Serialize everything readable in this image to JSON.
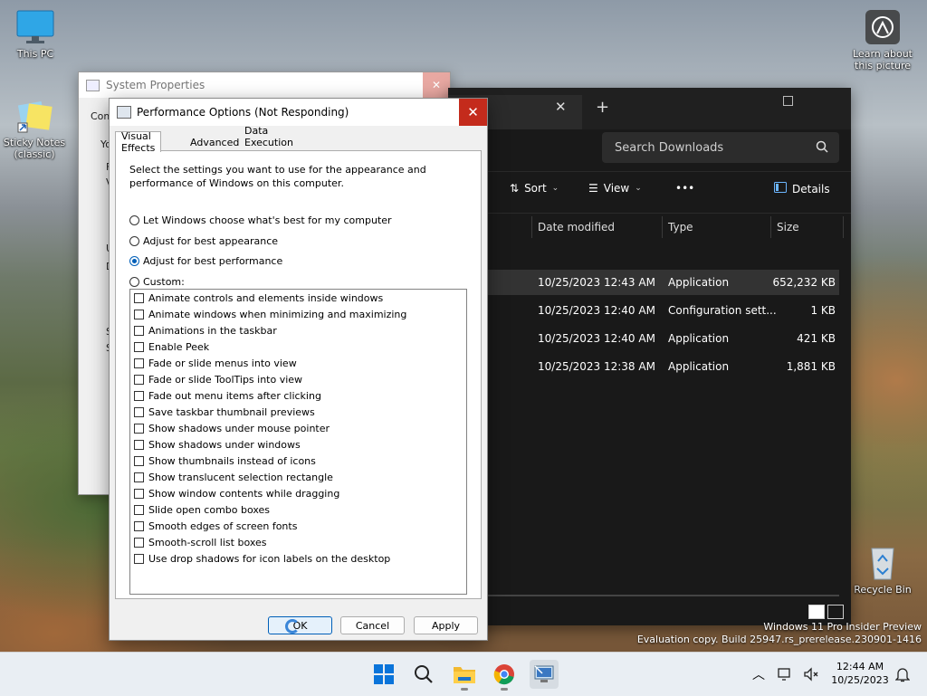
{
  "desktop": {
    "icons": [
      {
        "label": "This PC"
      },
      {
        "label": "Sticky Notes (classic)"
      },
      {
        "label": "Learn about this picture"
      },
      {
        "label": "Recycle Bin"
      }
    ]
  },
  "system_properties": {
    "title": "System Properties",
    "fragments": [
      "Com",
      "Yo",
      "F",
      "V",
      "U",
      "D",
      "S",
      "S"
    ]
  },
  "explorer": {
    "search_placeholder": "Search Downloads",
    "toolbar": {
      "sort": "Sort",
      "view": "View",
      "more": "•••",
      "details": "Details"
    },
    "columns": {
      "date": "Date modified",
      "type": "Type",
      "size": "Size"
    },
    "rows": [
      {
        "date": "10/25/2023 12:43 AM",
        "type": "Application",
        "size": "652,232 KB"
      },
      {
        "date": "10/25/2023 12:40 AM",
        "type": "Configuration sett...",
        "size": "1 KB"
      },
      {
        "date": "10/25/2023 12:40 AM",
        "type": "Application",
        "size": "421 KB"
      },
      {
        "date": "10/25/2023 12:38 AM",
        "type": "Application",
        "size": "1,881 KB"
      }
    ]
  },
  "perf": {
    "title": "Performance Options (Not Responding)",
    "tabs": [
      "Visual Effects",
      "Advanced",
      "Data Execution Prevention"
    ],
    "description": "Select the settings you want to use for the appearance and performance of Windows on this computer.",
    "radios": [
      {
        "label": "Let Windows choose what's best for my computer",
        "selected": false
      },
      {
        "label": "Adjust for best appearance",
        "selected": false
      },
      {
        "label": "Adjust for best performance",
        "selected": true
      },
      {
        "label": "Custom:",
        "selected": false
      }
    ],
    "options": [
      "Animate controls and elements inside windows",
      "Animate windows when minimizing and maximizing",
      "Animations in the taskbar",
      "Enable Peek",
      "Fade or slide menus into view",
      "Fade or slide ToolTips into view",
      "Fade out menu items after clicking",
      "Save taskbar thumbnail previews",
      "Show shadows under mouse pointer",
      "Show shadows under windows",
      "Show thumbnails instead of icons",
      "Show translucent selection rectangle",
      "Show window contents while dragging",
      "Slide open combo boxes",
      "Smooth edges of screen fonts",
      "Smooth-scroll list boxes",
      "Use drop shadows for icon labels on the desktop"
    ],
    "buttons": {
      "ok": "OK",
      "cancel": "Cancel",
      "apply": "Apply"
    }
  },
  "watermark": {
    "line1": "Windows 11 Pro Insider Preview",
    "line2": "Evaluation copy. Build 25947.rs_prerelease.230901-1416"
  },
  "taskbar": {
    "time": "12:44 AM",
    "date": "10/25/2023"
  },
  "colors": {
    "accent": "#005fb8",
    "close_red": "#c42b1c",
    "explorer_bg": "#191919"
  }
}
